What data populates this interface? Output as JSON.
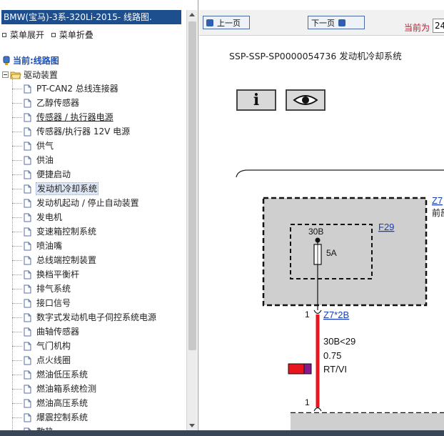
{
  "left_panel": {
    "title": "BMW(宝马)-3系-320Li-2015- 线路图.",
    "expand_label": "菜单展开",
    "collapse_label": "菜单折叠",
    "current_label": "当前:线路图",
    "folder_label": "驱动装置",
    "items": [
      {
        "label": "PT-CAN2 总线连接器"
      },
      {
        "label": "乙醇传感器"
      },
      {
        "label": "传感器 / 执行器电源"
      },
      {
        "label": "传感器/执行器 12V 电源"
      },
      {
        "label": "供气"
      },
      {
        "label": "供油"
      },
      {
        "label": "便捷启动"
      },
      {
        "label": "发动机冷却系统"
      },
      {
        "label": "发动机起动 / 停止自动装置"
      },
      {
        "label": "发电机"
      },
      {
        "label": "变速箱控制系统"
      },
      {
        "label": "喷油嘴"
      },
      {
        "label": "总线端控制装置"
      },
      {
        "label": "换档平衡杆"
      },
      {
        "label": "排气系统"
      },
      {
        "label": "接口信号"
      },
      {
        "label": "数字式发动机电子伺控系统电源"
      },
      {
        "label": "曲轴传感器"
      },
      {
        "label": "气门机构"
      },
      {
        "label": "点火线圈"
      },
      {
        "label": "燃油低压系统"
      },
      {
        "label": "燃油箱系统检测"
      },
      {
        "label": "燃油高压系统"
      },
      {
        "label": "爆震控制系统"
      },
      {
        "label": "散热"
      }
    ]
  },
  "toolbar": {
    "prev_label": "上一页",
    "next_label": "下一页",
    "current_page_label": "当前为",
    "current_page_value": "24"
  },
  "document": {
    "title": "SSP-SSP-SP0000054736 发动机冷却系统",
    "info_icon_text": "i"
  },
  "diagram": {
    "connector_top": "Z7",
    "connector_top_note": "前部",
    "fuse_id": "F29",
    "fuse_terminal": "30B",
    "fuse_rating": "5A",
    "pin_top": "1",
    "connector_link": "Z7*2B",
    "wire_signal": "30B<29",
    "wire_gauge": "0.75",
    "wire_color_code": "RT/VI",
    "pin_bottom": "1",
    "wire_color_primary": "#e8141e",
    "wire_color_secondary": "#8a1a8c"
  }
}
